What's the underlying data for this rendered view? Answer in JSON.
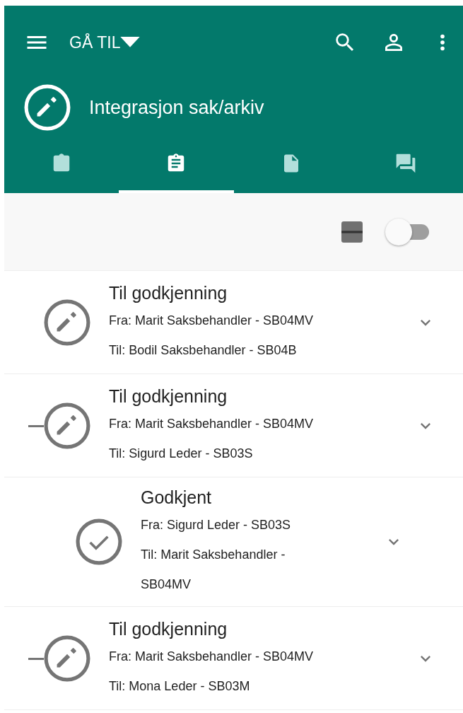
{
  "app_bar": {
    "nav_label": "GÅ TIL"
  },
  "header": {
    "title": "Integrasjon sak/arkiv"
  },
  "tabs": [
    {
      "selected": false
    },
    {
      "selected": true
    },
    {
      "selected": false
    },
    {
      "selected": false
    }
  ],
  "toolbar": {
    "toggle": {
      "on": false
    }
  },
  "items": [
    {
      "kind": "pending",
      "title": "Til godkjenning",
      "from": "Fra: Marit Saksbehandler - SB04MV",
      "to": "Til: Bodil Saksbehandler - SB04B",
      "connector": false
    },
    {
      "kind": "pending",
      "title": "Til godkjenning",
      "from": "Fra: Marit Saksbehandler - SB04MV",
      "to": "Til: Sigurd Leder - SB03S",
      "connector": true,
      "children": [
        {
          "kind": "approved",
          "title": "Godkjent",
          "from": "Fra: Sigurd Leder - SB03S",
          "to": "Til: Marit Saksbehandler - SB04MV",
          "connector": false
        }
      ]
    },
    {
      "kind": "pending",
      "title": "Til godkjenning",
      "from": "Fra: Marit Saksbehandler - SB04MV",
      "to": "Til: Mona Leder - SB03M",
      "connector": true
    }
  ]
}
